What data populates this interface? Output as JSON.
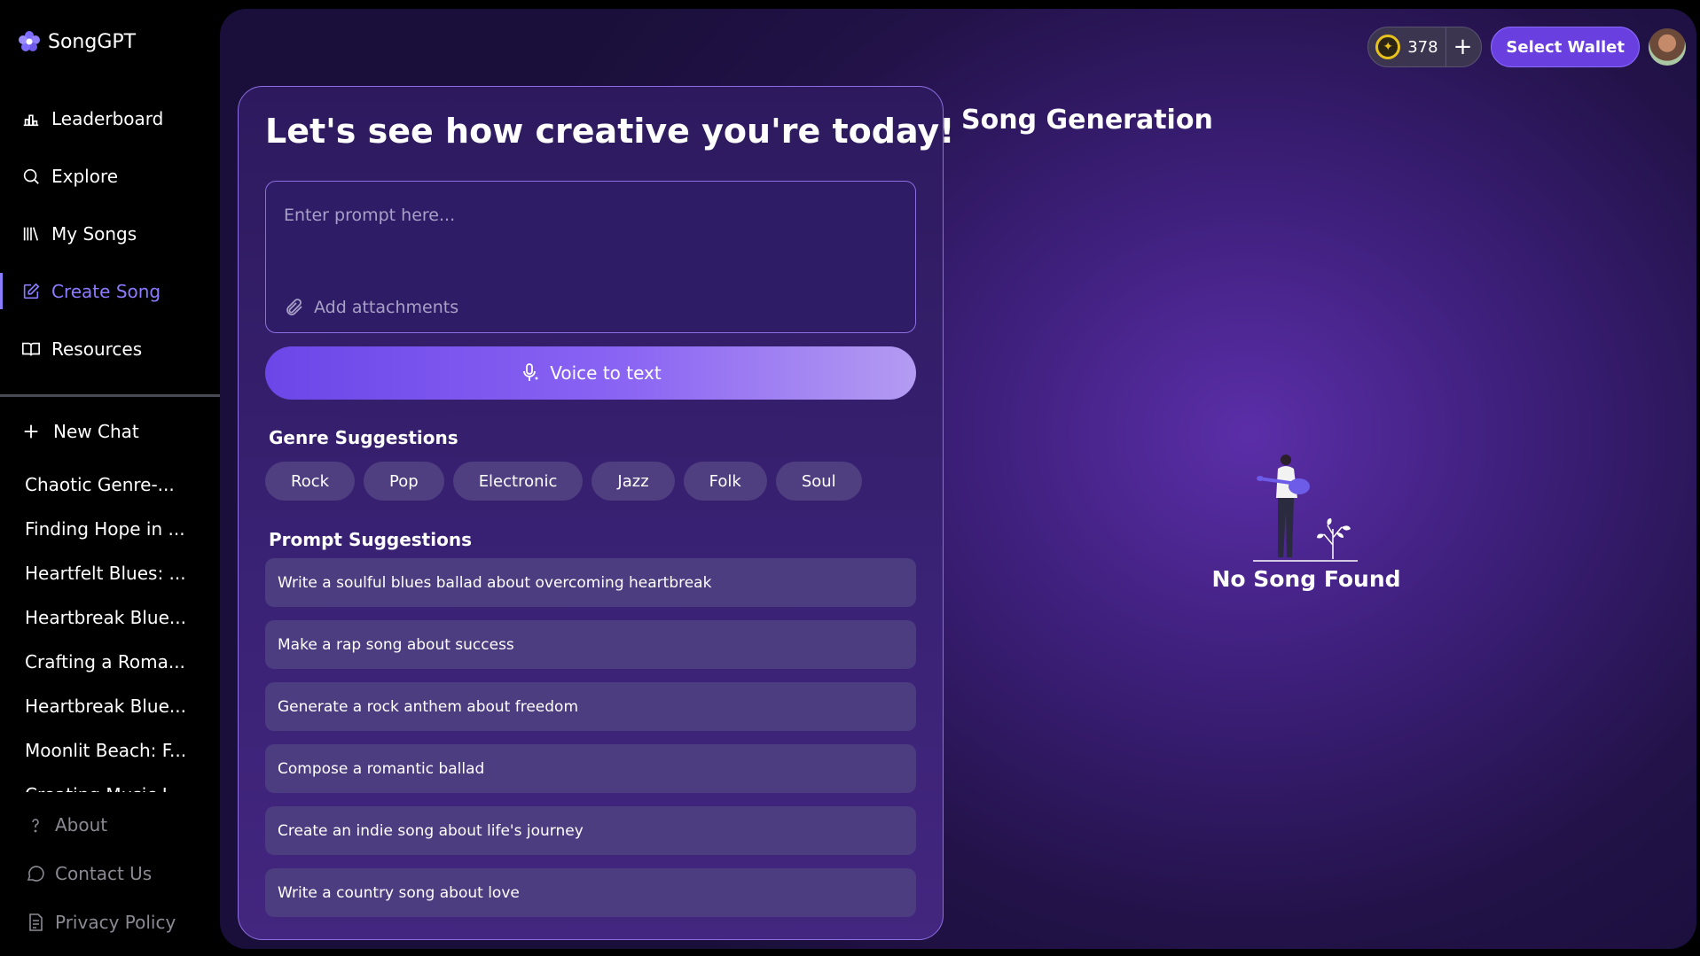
{
  "app": {
    "name": "SongGPT"
  },
  "nav": [
    {
      "label": "Leaderboard",
      "icon": "leaderboard-icon",
      "active": false
    },
    {
      "label": "Explore",
      "icon": "search-icon",
      "active": false
    },
    {
      "label": "My Songs",
      "icon": "library-icon",
      "active": false
    },
    {
      "label": "Create Song",
      "icon": "edit-icon",
      "active": true
    },
    {
      "label": "Resources",
      "icon": "book-icon",
      "active": false
    }
  ],
  "new_chat_label": "New Chat",
  "chats": [
    "Chaotic Genre-...",
    "Finding Hope in ...",
    "Heartfelt Blues: ...",
    "Heartbreak Blue...",
    "Crafting a Roma...",
    "Heartbreak Blue...",
    "Moonlit Beach: F...",
    "Creating Music I..."
  ],
  "footer": {
    "about": "About",
    "contact": "Contact Us",
    "privacy": "Privacy Policy"
  },
  "topbar": {
    "credits": "378",
    "wallet_label": "Select Wallet"
  },
  "creator": {
    "title": "Let's see how creative you're today!",
    "prompt_placeholder": "Enter prompt here...",
    "attach_label": "Add attachments",
    "voice_label": "Voice to text",
    "genre_title": "Genre Suggestions",
    "genres": [
      "Rock",
      "Pop",
      "Electronic",
      "Jazz",
      "Folk",
      "Soul"
    ],
    "prompt_title": "Prompt Suggestions",
    "prompts": [
      "Write a soulful blues ballad about overcoming heartbreak",
      "Make a rap song about success",
      "Generate a rock anthem about freedom",
      "Compose a romantic ballad",
      "Create an indie song about life's journey",
      "Write a country song about love"
    ]
  },
  "generation": {
    "title": "Song Generation",
    "empty_text": "No Song Found"
  },
  "colors": {
    "accent": "#8b7bff",
    "wallet": "#6a3fe0",
    "coin": "#e8c21c"
  }
}
